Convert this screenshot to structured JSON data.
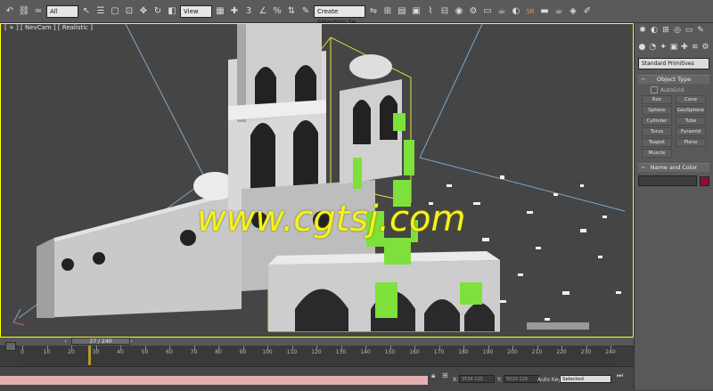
{
  "toolbar": {
    "filter_select": "All",
    "view_select": "View",
    "selection_set": "Create Selection Se",
    "tool_icons": [
      "undo-icon",
      "redo-icon",
      "link-icon",
      "unlink-icon",
      "bind-icon",
      "select-icon",
      "select-name-icon",
      "rect-select-icon",
      "window-icon",
      "move-icon",
      "rotate-icon",
      "scale-icon",
      "pivot-icon",
      "snap-icon",
      "angle-snap-icon",
      "percent-snap-icon",
      "spinner-snap-icon",
      "mirror-icon",
      "align-icon",
      "layer-icon",
      "curve-icon",
      "schematic-icon",
      "material-icon",
      "render-setup-icon",
      "render-icon"
    ]
  },
  "viewport": {
    "label": "[ + ] [ NevCam ] [ Realistic ]"
  },
  "watermark": "www.cgtsj.com",
  "command_panel": {
    "dropdown": "Standard Primitives",
    "object_type_title": "Object Type",
    "autogrid_label": "AutoGrid",
    "primitives": [
      "Box",
      "Cone",
      "Sphere",
      "GeoSphere",
      "Cylinder",
      "Tube",
      "Torus",
      "Pyramid",
      "Teapot",
      "Plane",
      "Muscle"
    ],
    "name_color_title": "Name and Color",
    "object_color": "#8a0d3a"
  },
  "timeline": {
    "frame_indicator": "27 / 240",
    "ticks": [
      0,
      10,
      20,
      30,
      40,
      50,
      60,
      70,
      80,
      90,
      100,
      110,
      120,
      130,
      140,
      150,
      160,
      170,
      180,
      190,
      200,
      210,
      220,
      230,
      240
    ],
    "current_frame": 27,
    "total_frames": 240
  },
  "status": {
    "x_label": "X:",
    "x_value": "3534.125",
    "y_label": "Y:",
    "y_value": "5020.129",
    "auto_key_label": "Auto Key",
    "selected_label": "Selected"
  }
}
